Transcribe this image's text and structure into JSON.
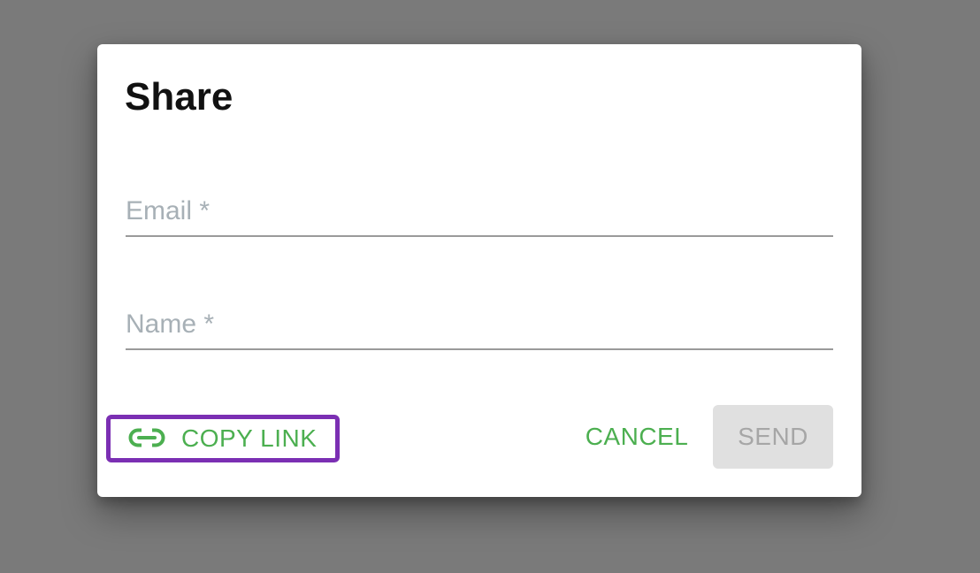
{
  "dialog": {
    "title": "Share",
    "fields": {
      "email_placeholder": "Email *",
      "email_value": "",
      "name_placeholder": "Name *",
      "name_value": ""
    },
    "actions": {
      "copy_link_label": "COPY LINK",
      "copy_link_icon": "link-icon",
      "cancel_label": "CANCEL",
      "send_label": "SEND"
    }
  },
  "colors": {
    "backdrop": "#7a7a7a",
    "accent_green": "#4caf50",
    "focus_outline": "#7b2fb3",
    "disabled_bg": "#e0e0e0",
    "disabled_text": "#a6a6a6",
    "placeholder": "#a7b0b6"
  }
}
